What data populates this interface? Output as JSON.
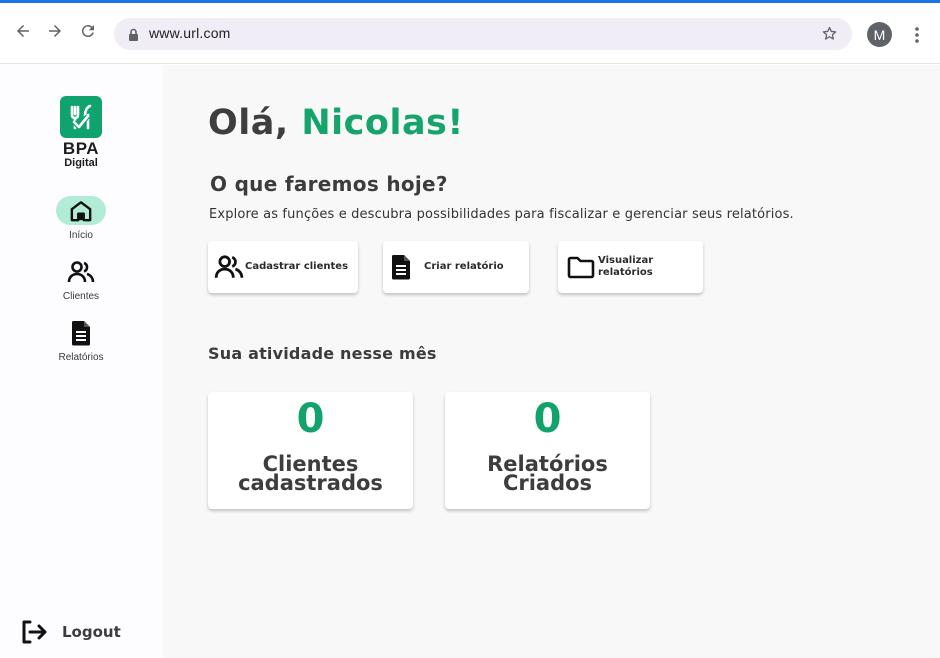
{
  "browser": {
    "url": "www.url.com",
    "profile_initial": "M",
    "accent_color": "#1a73e8"
  },
  "sidebar": {
    "logo_line1": "BPA",
    "logo_line2": "Digital",
    "items": [
      {
        "label": "Início",
        "icon": "home-icon",
        "active": true
      },
      {
        "label": "Clientes",
        "icon": "users-icon",
        "active": false
      },
      {
        "label": "Relatórios",
        "icon": "document-icon",
        "active": false
      }
    ],
    "logout_label": "Logout"
  },
  "main": {
    "greeting_prefix": "Olá, ",
    "greeting_name": "Nicolas!",
    "subtitle": "O que faremos hoje?",
    "description": "Explore as funções e descubra possibilidades para fiscalizar e gerenciar seus relatórios.",
    "actions": [
      {
        "label": "Cadastrar clientes",
        "icon": "users-icon"
      },
      {
        "label": "Criar relatório",
        "icon": "document-icon"
      },
      {
        "label": "Visualizar\nrelatórios",
        "icon": "folder-icon"
      }
    ],
    "activity_title": "Sua atividade nesse mês",
    "stats": [
      {
        "value": "0",
        "label": "Clientes\ncadastrados"
      },
      {
        "value": "0",
        "label": "Relatórios\nCriados"
      }
    ]
  },
  "colors": {
    "brand_green": "#14a46c",
    "active_nav_bg": "#b2ecd6"
  }
}
